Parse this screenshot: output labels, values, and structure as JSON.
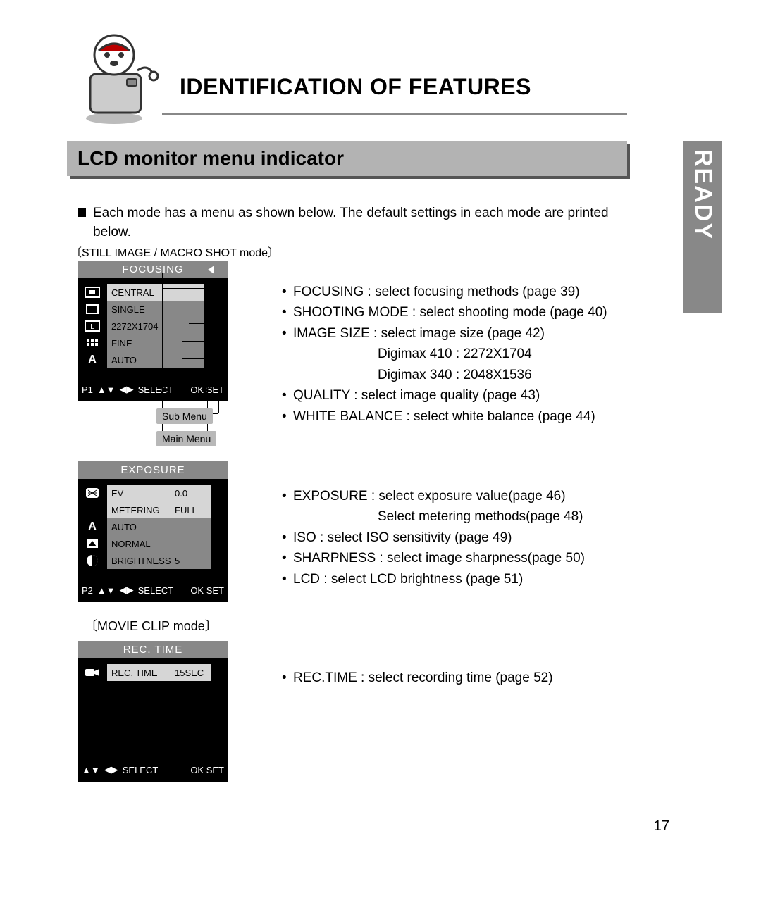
{
  "side_tab": "READY",
  "title": "IDENTIFICATION OF FEATURES",
  "section": "LCD monitor menu indicator",
  "intro": "Each mode has a menu as shown below. The default settings in each mode are printed below.",
  "mode_still_label": "STILL IMAGE / MACRO SHOT mode",
  "mode_movie_label": "MOVIE CLIP mode",
  "callout_sub": "Sub Menu",
  "callout_main": "Main Menu",
  "lcd_focusing": {
    "title": "FOCUSING",
    "items": [
      "CENTRAL",
      "SINGLE",
      "2272X1704",
      "FINE",
      "AUTO"
    ],
    "icons": [
      "focus-area-icon",
      "single-shot-icon",
      "size-l-icon",
      "quality-grid-icon",
      "auto-a-icon"
    ],
    "footer_page": "P1",
    "footer_select": "SELECT",
    "footer_set": "OK SET"
  },
  "lcd_exposure": {
    "title": "EXPOSURE",
    "items": [
      "EV",
      "METERING",
      "AUTO",
      "NORMAL",
      "BRIGHTNESS"
    ],
    "values": [
      "0.0",
      "FULL",
      "",
      "",
      "5"
    ],
    "icons": [
      "ev-icon",
      "blank-icon",
      "iso-a-icon",
      "sharpness-icon",
      "lcd-bright-icon"
    ],
    "footer_page": "P2",
    "footer_select": "SELECT",
    "footer_set": "OK SET"
  },
  "lcd_rectime": {
    "title": "REC. TIME",
    "items": [
      "REC. TIME"
    ],
    "values": [
      "15SEC"
    ],
    "icons": [
      "movie-icon"
    ],
    "footer_select": "SELECT",
    "footer_set": "OK SET"
  },
  "desc_focusing": [
    "FOCUSING : select focusing methods (page 39)",
    "SHOOTING MODE : select shooting mode (page 40)",
    "IMAGE SIZE : select image size (page 42)",
    "Digimax 410 : 2272X1704",
    "Digimax 340 : 2048X1536",
    "QUALITY : select image quality (page 43)",
    "WHITE BALANCE : select white balance (page 44)"
  ],
  "desc_exposure": [
    "EXPOSURE : select exposure value(page 46)",
    "Select metering methods(page 48)",
    "ISO : select ISO sensitivity (page 49)",
    "SHARPNESS : select image sharpness(page 50)",
    "LCD : select LCD brightness (page 51)"
  ],
  "desc_rectime": [
    "REC.TIME : select recording time (page 52)"
  ],
  "page_number": "17"
}
